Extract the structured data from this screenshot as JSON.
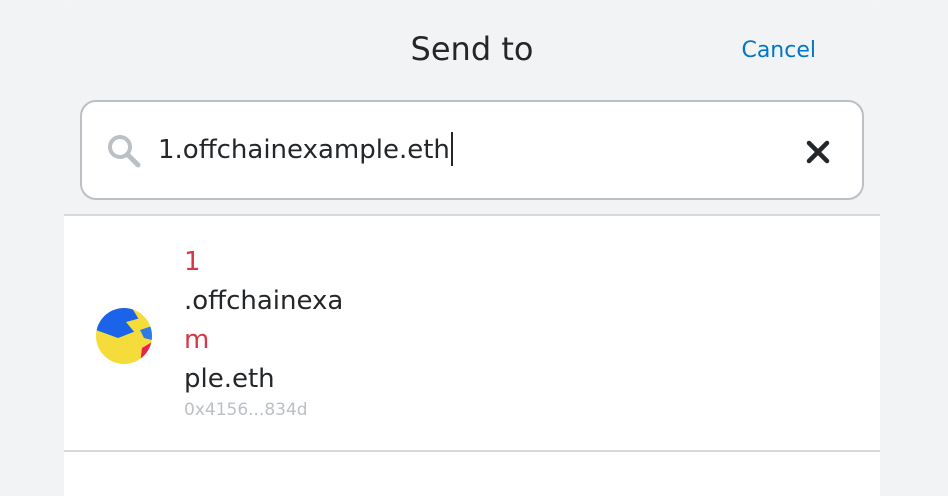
{
  "header": {
    "title": "Send to",
    "cancel_label": "Cancel"
  },
  "search": {
    "icon": "search-icon",
    "value": "1.offchainexample.eth",
    "clear_icon": "close-icon"
  },
  "results": [
    {
      "name_parts": [
        "1",
        ".offchainexa",
        "m",
        "ple.eth"
      ],
      "name_highlight": [
        true,
        false,
        true,
        false
      ],
      "address": "0x4156...834d",
      "avatar_colors": [
        "#f5dc3a",
        "#1b63e8",
        "#e6224f",
        "#2f7ae5"
      ]
    }
  ],
  "colors": {
    "accent": "#0376c9",
    "highlight": "#d73847",
    "muted": "#bbc0c5"
  }
}
